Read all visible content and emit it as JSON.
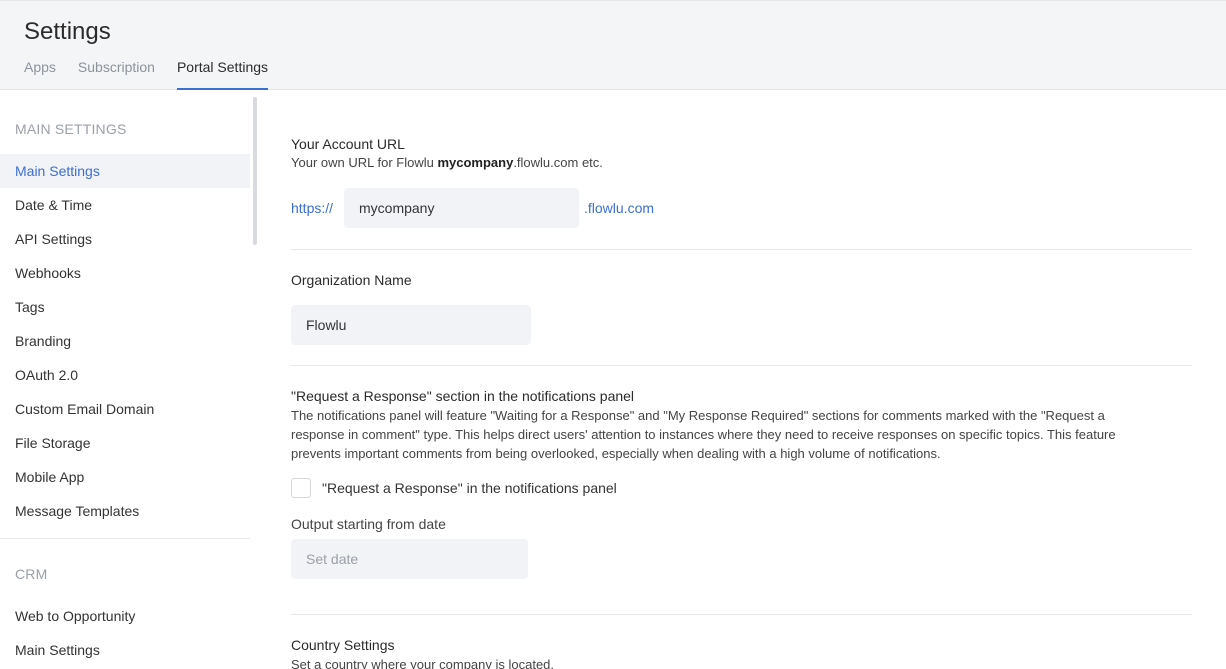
{
  "header": {
    "title": "Settings",
    "tabs": [
      {
        "label": "Apps"
      },
      {
        "label": "Subscription"
      },
      {
        "label": "Portal Settings"
      }
    ]
  },
  "sidebar": {
    "main_heading": "MAIN SETTINGS",
    "items": [
      {
        "label": "Main Settings"
      },
      {
        "label": "Date & Time"
      },
      {
        "label": "API Settings"
      },
      {
        "label": "Webhooks"
      },
      {
        "label": "Tags"
      },
      {
        "label": "Branding"
      },
      {
        "label": "OAuth 2.0"
      },
      {
        "label": "Custom Email Domain"
      },
      {
        "label": "File Storage"
      },
      {
        "label": "Mobile App"
      },
      {
        "label": "Message Templates"
      }
    ],
    "crm_heading": "CRM",
    "crm_items": [
      {
        "label": "Web to Opportunity"
      },
      {
        "label": "Main Settings"
      }
    ]
  },
  "main": {
    "account_url": {
      "title": "Your Account URL",
      "desc_prefix": "Your own URL for Flowlu ",
      "desc_bold": "mycompany",
      "desc_suffix": ".flowlu.com etc.",
      "prefix": "https://",
      "value": "mycompany",
      "suffix": ".flowlu.com"
    },
    "org_name": {
      "title": "Organization Name",
      "value": "Flowlu"
    },
    "request_response": {
      "title": "\"Request a Response\" section in the notifications panel",
      "line1": "The notifications panel will feature \"Waiting for a Response\" and \"My Response Required\" sections for comments marked with the \"Request a",
      "line2": "response in comment\" type. This helps direct users' attention to instances where they need to receive responses on specific topics. This feature",
      "line3": "prevents important comments from being overlooked, especially when dealing with a high volume of notifications.",
      "checkbox_label": "\"Request a Response\" in the notifications panel",
      "date_label": "Output starting from date",
      "date_placeholder": "Set date"
    },
    "country": {
      "title": "Country Settings",
      "desc": "Set a country where your company is located."
    }
  }
}
